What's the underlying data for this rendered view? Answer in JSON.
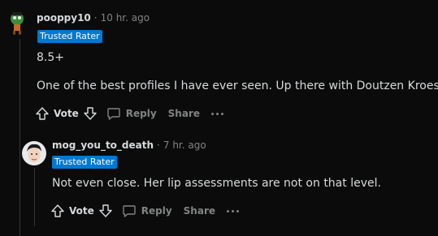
{
  "comments": [
    {
      "username": "pooppy10",
      "separator": "·",
      "time": "10 hr. ago",
      "flair": "Trusted Rater",
      "lines": [
        "8.5+",
        "One of the best profiles I have ever seen. Up there with Doutzen Kroes."
      ],
      "actions": {
        "vote": "Vote",
        "reply": "Reply",
        "share": "Share"
      }
    },
    {
      "username": "mog_you_to_death",
      "separator": "·",
      "time": "7 hr. ago",
      "flair": "Trusted Rater",
      "lines": [
        "Not even close. Her lip assessments are not on that level."
      ],
      "actions": {
        "vote": "Vote",
        "reply": "Reply",
        "share": "Share"
      }
    }
  ],
  "colors": {
    "background": "#0b0b0b",
    "text": "#d7dadc",
    "muted": "#818384",
    "flair_bg": "#0079d3",
    "thread_line": "#343536"
  },
  "icons": [
    "upvote-icon",
    "downvote-icon",
    "comment-icon",
    "more-options-icon"
  ]
}
